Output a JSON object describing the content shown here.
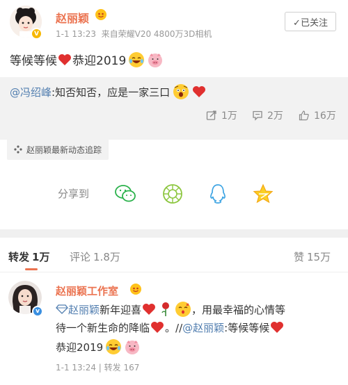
{
  "post": {
    "author": "赵丽颖",
    "meta": "1-1 13:23  来自荣耀V20 4800万3D相机",
    "follow_label": "✓已关注",
    "text": "等候等候",
    "text_suffix": "恭迎2019",
    "repost_user": "@冯绍峰",
    "repost_text": ":知否知否，应是一家三口",
    "stats": {
      "repost": "1万",
      "comment": "2万",
      "like": "16万"
    }
  },
  "topic": {
    "label": "赵丽颖最新动态追踪"
  },
  "share": {
    "label": "分享到"
  },
  "tabs": {
    "repost_label": "转发",
    "repost_count": "1万",
    "comment_label": "评论",
    "comment_count": "1.8万",
    "like_label": "赞",
    "like_count": "15万"
  },
  "reply": {
    "author": "赵丽颖工作室",
    "line1_user": "赵丽颖",
    "line1_text": "新年迎喜",
    "line1_tail": "，用最幸福的心情等",
    "line2": "待一个新生命的降临",
    "line2_tail": "。//",
    "line2_user": "@赵丽颖",
    "line2_end": ":等候等候",
    "line3": "恭迎2019",
    "meta": "1-1 13:24 | 转发 167"
  },
  "colors": {
    "accent": "#eb7350",
    "link": "#507daf",
    "muted": "#999999",
    "heart": "#e0302f"
  },
  "icons": [
    "wechat-icon",
    "moments-icon",
    "qq-icon",
    "qzone-icon",
    "repost-icon",
    "comment-icon",
    "like-icon"
  ]
}
